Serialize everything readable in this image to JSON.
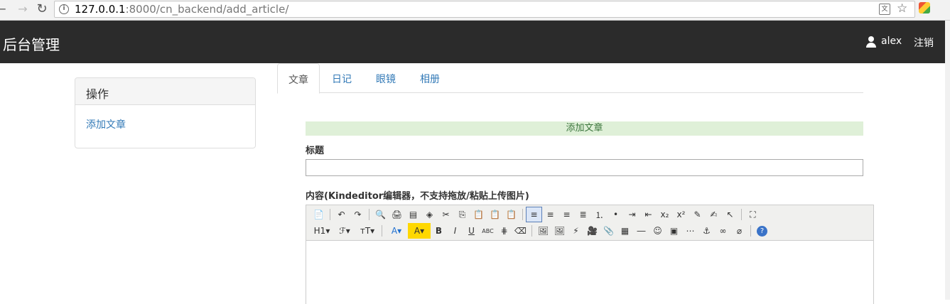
{
  "browser": {
    "url_host": "127.0.0.1",
    "url_port_path": ":8000/cn_backend/add_article/"
  },
  "navbar": {
    "brand": "后台管理",
    "user": "alex",
    "logout": "注销"
  },
  "sidebar": {
    "heading": "操作",
    "link": "添加文章"
  },
  "tabs": [
    {
      "label": "文章",
      "active": true
    },
    {
      "label": "日记",
      "active": false
    },
    {
      "label": "眼镜",
      "active": false
    },
    {
      "label": "相册",
      "active": false
    }
  ],
  "form": {
    "header": "添加文章",
    "title_label": "标题",
    "title_value": "",
    "content_label": "内容(Kindeditor编辑器，不支持拖放/粘贴上传图片)"
  },
  "editor": {
    "row1": [
      {
        "icon": "source-icon",
        "glyph": "📄"
      },
      {
        "sep": true
      },
      {
        "icon": "undo-icon",
        "glyph": "↶"
      },
      {
        "icon": "redo-icon",
        "glyph": "↷"
      },
      {
        "sep": true
      },
      {
        "icon": "preview-icon",
        "glyph": "🔍"
      },
      {
        "icon": "print-icon",
        "glyph": "🖨"
      },
      {
        "icon": "template-icon",
        "glyph": "▤"
      },
      {
        "icon": "code-icon",
        "glyph": "◈"
      },
      {
        "icon": "cut-icon",
        "glyph": "✂"
      },
      {
        "icon": "copy-icon",
        "glyph": "⎘"
      },
      {
        "icon": "paste-icon",
        "glyph": "📋"
      },
      {
        "icon": "paste-plain-icon",
        "glyph": "📋"
      },
      {
        "icon": "paste-word-icon",
        "glyph": "📋"
      },
      {
        "sep": true
      },
      {
        "icon": "align-left-icon",
        "glyph": "≡",
        "selected": true
      },
      {
        "icon": "align-center-icon",
        "glyph": "≡"
      },
      {
        "icon": "align-right-icon",
        "glyph": "≡"
      },
      {
        "icon": "align-justify-icon",
        "glyph": "≣"
      },
      {
        "icon": "ordered-list-icon",
        "glyph": "⒈"
      },
      {
        "icon": "unordered-list-icon",
        "glyph": "•"
      },
      {
        "icon": "indent-icon",
        "glyph": "⇥"
      },
      {
        "icon": "outdent-icon",
        "glyph": "⇤"
      },
      {
        "icon": "subscript-icon",
        "glyph": "x₂"
      },
      {
        "icon": "superscript-icon",
        "glyph": "x²"
      },
      {
        "icon": "clear-html-icon",
        "glyph": "✎"
      },
      {
        "icon": "quick-format-icon",
        "glyph": "✍"
      },
      {
        "icon": "select-all-icon",
        "glyph": "↖"
      },
      {
        "sep": true
      },
      {
        "icon": "fullscreen-icon",
        "glyph": "⛶"
      }
    ],
    "row2": [
      {
        "icon": "heading-icon",
        "glyph": "H1▾",
        "wide": true
      },
      {
        "icon": "font-family-icon",
        "glyph": "ℱ▾",
        "wide": true
      },
      {
        "icon": "font-size-icon",
        "glyph": "ᴛT▾",
        "wide": true
      },
      {
        "sep": true
      },
      {
        "icon": "font-color-icon",
        "glyph": "A▾",
        "wide": true,
        "color": "#1e6fd0"
      },
      {
        "icon": "highlight-icon",
        "glyph": "A▾",
        "wide": true,
        "bg": "#ffd800"
      },
      {
        "icon": "bold-icon",
        "glyph": "B"
      },
      {
        "icon": "italic-icon",
        "glyph": "I"
      },
      {
        "icon": "underline-icon",
        "glyph": "U"
      },
      {
        "icon": "strikethrough-icon",
        "glyph": "ABC"
      },
      {
        "icon": "line-height-icon",
        "glyph": "⋕"
      },
      {
        "icon": "remove-format-icon",
        "glyph": "⌫"
      },
      {
        "sep": true
      },
      {
        "icon": "image-icon",
        "glyph": "🖼"
      },
      {
        "icon": "multi-image-icon",
        "glyph": "🖼"
      },
      {
        "icon": "flash-icon",
        "glyph": "⚡"
      },
      {
        "icon": "media-icon",
        "glyph": "🎥"
      },
      {
        "icon": "insert-file-icon",
        "glyph": "📎"
      },
      {
        "icon": "table-icon",
        "glyph": "▦"
      },
      {
        "icon": "hr-icon",
        "glyph": "―"
      },
      {
        "icon": "emoticons-icon",
        "glyph": "☺"
      },
      {
        "icon": "baidu-map-icon",
        "glyph": "▣"
      },
      {
        "icon": "page-break-icon",
        "glyph": "⋯"
      },
      {
        "icon": "anchor-icon",
        "glyph": "⚓"
      },
      {
        "icon": "link-icon",
        "glyph": "∞"
      },
      {
        "icon": "unlink-icon",
        "glyph": "⌀"
      },
      {
        "sep": true
      },
      {
        "icon": "help-icon",
        "glyph": "?"
      }
    ]
  }
}
